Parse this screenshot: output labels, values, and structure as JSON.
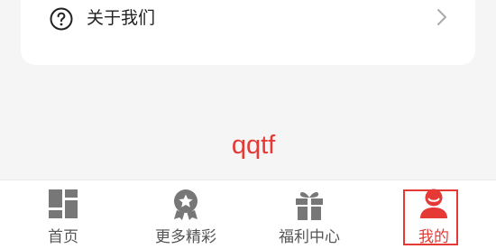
{
  "menu": {
    "about": {
      "label": "关于我们",
      "icon": "help-circle-icon",
      "chevron_icon": "chevron-right-icon"
    }
  },
  "brand_text": "qqtf",
  "tabbar": {
    "tabs": [
      {
        "label": "首页",
        "icon": "dashboard-grid-icon",
        "active": false
      },
      {
        "label": "更多精彩",
        "icon": "star-medal-icon",
        "active": false
      },
      {
        "label": "福利中心",
        "icon": "gift-icon",
        "active": false
      },
      {
        "label": "我的",
        "icon": "user-profile-icon",
        "active": true
      }
    ]
  },
  "colors": {
    "accent": "#e53935",
    "inactive_icon": "#777777",
    "background": "#f5f5f5",
    "card": "#ffffff"
  }
}
